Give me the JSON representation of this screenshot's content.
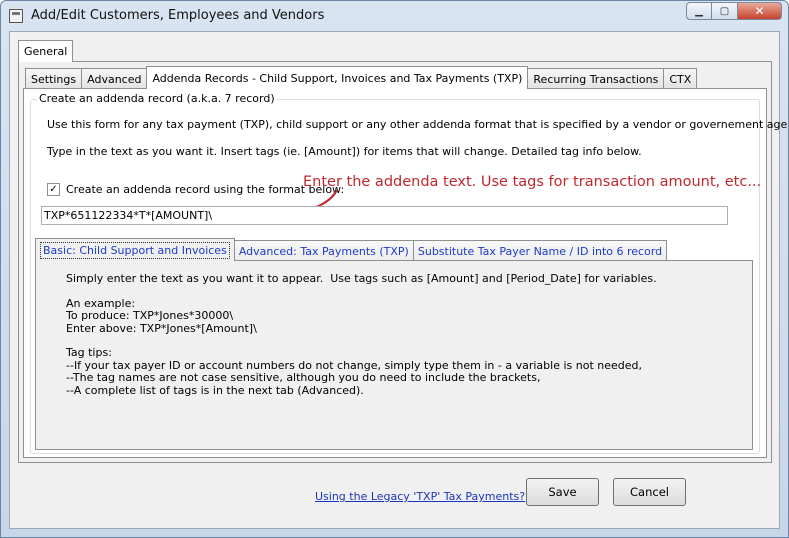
{
  "window": {
    "title": "Add/Edit Customers, Employees and Vendors",
    "controls": {
      "minimize": "▁",
      "maximize": "▢",
      "close": "✕"
    }
  },
  "outer_tab": {
    "label": "General"
  },
  "tabs": [
    {
      "label": "Settings"
    },
    {
      "label": "Advanced"
    },
    {
      "label": "Addenda Records - Child Support, Invoices and Tax Payments (TXP)"
    },
    {
      "label": "Recurring Transactions"
    },
    {
      "label": "CTX"
    }
  ],
  "addenda": {
    "group_label": "Create an addenda record (a.k.a. 7 record)",
    "intro1": "Use this form for any tax payment (TXP), child support or any other addenda format that is specified by a vendor or governement agency.",
    "intro2": "Type in the text as you want it.  Insert tags (ie. [Amount]) for items that will change. Detailed tag info below.",
    "checkbox_label": "Create an addenda record using the format below:",
    "checkbox_mark": "✓",
    "format_value": "TXP*651122334*T*[AMOUNT]\\",
    "annotation": "Enter the addenda text. Use tags for transaction amount, etc..."
  },
  "sub_tabs": [
    {
      "label": "Basic: Child Support and Invoices"
    },
    {
      "label": "Advanced: Tax Payments (TXP)"
    },
    {
      "label": "Substitute Tax Payer Name / ID into 6 record"
    }
  ],
  "basic_help": {
    "line1": "Simply enter the text as you want it to appear.  Use tags such as [Amount] and [Period_Date] for variables.",
    "line2": "An example:",
    "line3": "To produce: TXP*Jones*30000\\",
    "line4": "Enter above: TXP*Jones*[Amount]\\",
    "line5": "Tag tips:",
    "line6": "--If your tax payer ID or account numbers do not change, simply type them in - a variable is not needed,",
    "line7": "--The tag names are not case sensitive, although you do need to include the brackets,",
    "line8": "--A complete list of tags is in the next tab (Advanced)."
  },
  "footer": {
    "legacy_link": "Using the Legacy 'TXP' Tax Payments?",
    "save": "Save",
    "cancel": "Cancel"
  },
  "colors": {
    "annotation": "#c0282e",
    "link": "#1b35b8"
  }
}
